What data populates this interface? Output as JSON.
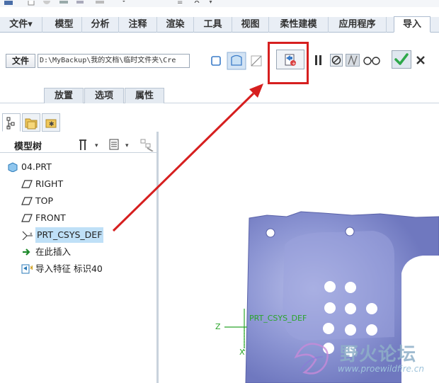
{
  "ribbon_tabs": [
    {
      "label": "文件",
      "dropdown": "▾"
    },
    {
      "label": "模型"
    },
    {
      "label": "分析"
    },
    {
      "label": "注释"
    },
    {
      "label": "渲染"
    },
    {
      "label": "工具"
    },
    {
      "label": "视图"
    },
    {
      "label": "柔性建模"
    },
    {
      "label": "应用程序"
    },
    {
      "label": "导入",
      "active": true
    }
  ],
  "import_ribbon": {
    "file_button_label": "文件",
    "file_path": "D:\\MyBackup\\我的文档\\临时文件夹\\Cre",
    "sub_tabs": [
      "放置",
      "选项",
      "属性"
    ]
  },
  "model_tree": {
    "title": "模型树",
    "items": [
      {
        "label": "04.PRT",
        "icon": "part-icon"
      },
      {
        "label": "RIGHT",
        "icon": "datum-plane-icon"
      },
      {
        "label": "TOP",
        "icon": "datum-plane-icon"
      },
      {
        "label": "FRONT",
        "icon": "datum-plane-icon"
      },
      {
        "label": "PRT_CSYS_DEF",
        "icon": "csys-icon",
        "selected": true
      },
      {
        "label": "在此插入",
        "icon": "insert-arrow-icon"
      },
      {
        "label": "导入特征 标识40",
        "icon": "import-feature-icon"
      }
    ]
  },
  "viewport": {
    "csys_label": "PRT_CSYS_DEF",
    "axis_z": "Z",
    "axis_x": "X"
  },
  "watermark": {
    "title": "野火论坛",
    "url": "www.proewildfire.cn"
  },
  "colors": {
    "highlight": "#d61f1f",
    "model": "#7f88c8",
    "accept": "#2ea84a",
    "csys": "#2aa52a"
  }
}
